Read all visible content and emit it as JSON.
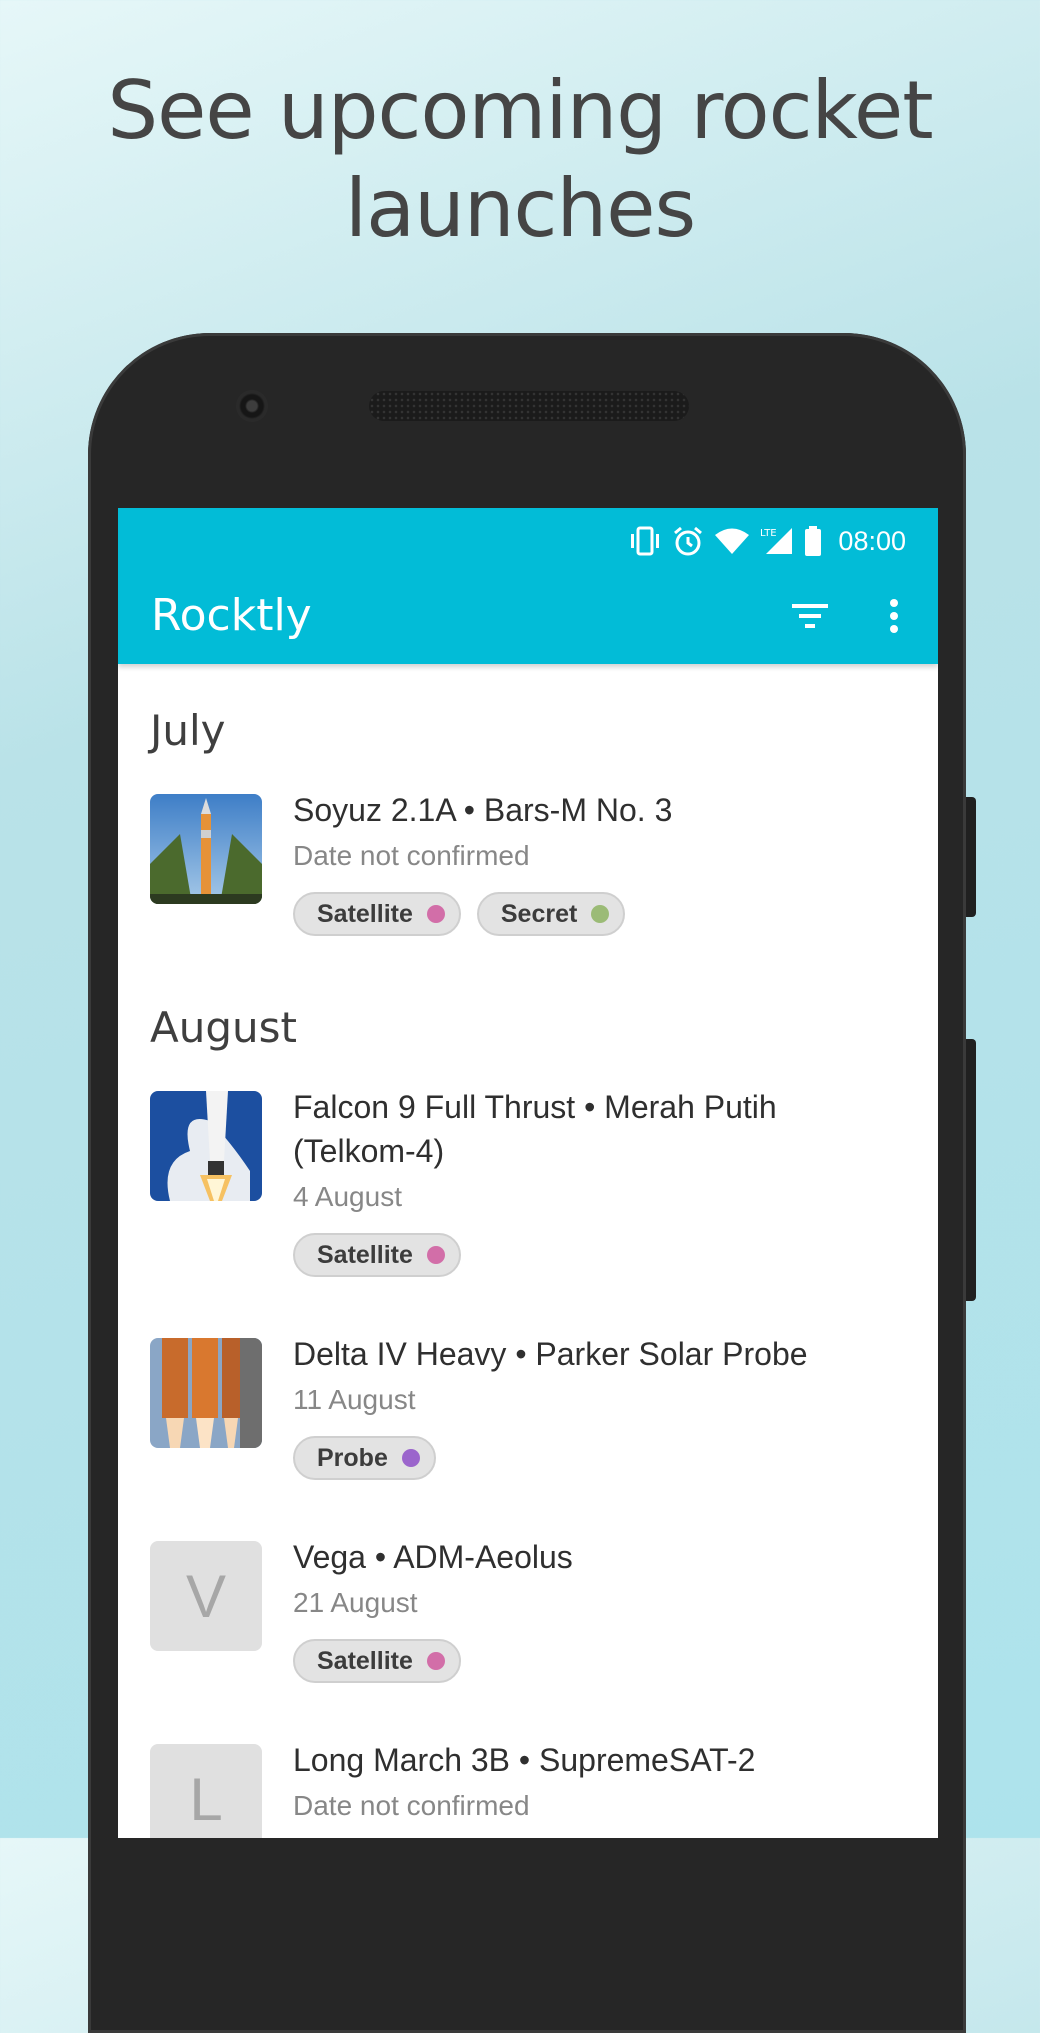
{
  "headline": {
    "line1": "See upcoming rocket",
    "line2": "launches"
  },
  "statusbar": {
    "time": "08:00",
    "network": "LTE"
  },
  "appbar": {
    "title": "Rocktly",
    "filter_icon": "filter-icon",
    "menu_icon": "more-vert-icon"
  },
  "colors": {
    "accent": "#02bcd7",
    "satellite": "#d26ea8",
    "secret": "#9bbb76",
    "probe": "#9b65cc"
  },
  "months": [
    "July",
    "August"
  ],
  "launches": [
    {
      "title": "Soyuz 2.1A • Bars-M No. 3",
      "date": "Date not confirmed",
      "tags": [
        {
          "label": "Satellite",
          "color": "#d26ea8"
        },
        {
          "label": "Secret",
          "color": "#9bbb76"
        }
      ]
    },
    {
      "title_line1": "Falcon 9 Full Thrust • Merah Putih",
      "title_line2": "(Telkom-4)",
      "date": "4 August",
      "tags": [
        {
          "label": "Satellite",
          "color": "#d26ea8"
        }
      ]
    },
    {
      "title": "Delta IV Heavy • Parker Solar Probe",
      "date": "11 August",
      "tags": [
        {
          "label": "Probe",
          "color": "#9b65cc"
        }
      ]
    },
    {
      "title": "Vega • ADM-Aeolus",
      "date": "21 August",
      "letter": "V",
      "tags": [
        {
          "label": "Satellite",
          "color": "#d26ea8"
        }
      ]
    },
    {
      "title": "Long March 3B • SupremeSAT-2",
      "date": "Date not confirmed",
      "letter": "L",
      "tags": []
    }
  ]
}
